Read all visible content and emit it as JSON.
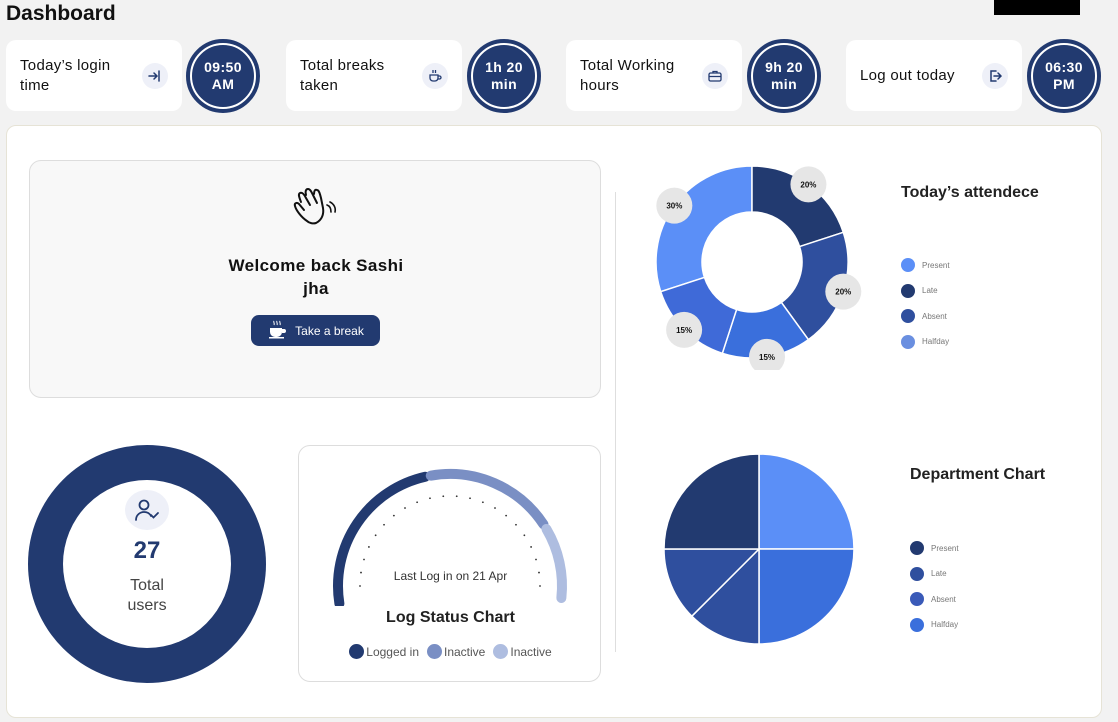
{
  "header": {
    "title": "Dashboard"
  },
  "stats": [
    {
      "label": "Today’s login time",
      "value": "09:50 AM",
      "icon": "login-arrow-icon"
    },
    {
      "label": "Total breaks taken",
      "value": "1h 20 min",
      "icon": "break-cup-icon"
    },
    {
      "label": "Total Working hours",
      "value": "9h 20 min",
      "icon": "briefcase-icon"
    },
    {
      "label": "Log out today",
      "value": "06:30 PM",
      "icon": "logout-arrow-icon"
    }
  ],
  "welcome": {
    "message": "Welcome back Sashi jha",
    "break_button": "Take a break",
    "icon": "waving-hand-icon"
  },
  "users": {
    "count": "27",
    "label": "Total users",
    "icon": "user-check-icon"
  },
  "log_status": {
    "title": "Log Status Chart",
    "last_login": "Last Log in on 21 Apr",
    "legend": [
      {
        "label": "Logged in",
        "color": "#223a70"
      },
      {
        "label": "Inactive",
        "color": "#7a8fc4"
      },
      {
        "label": "Inactive",
        "color": "#aebde0"
      }
    ]
  },
  "colors": {
    "primary": "#223a70",
    "accent_blue": "#5b8ff7",
    "mid_blue": "#3a6fdc",
    "royal_blue": "#2f4f9e"
  },
  "chart_data": [
    {
      "type": "donut",
      "title": "Today’s attendece",
      "series_labels": [
        "30%",
        "20%",
        "20%",
        "15%",
        "15%"
      ],
      "values": [
        30,
        20,
        20,
        15,
        15
      ],
      "colors": [
        "#5b8ff7",
        "#223a70",
        "#2f4f9e",
        "#3a6fdc",
        "#3f6ad8"
      ],
      "legend": [
        {
          "label": "Present",
          "color": "#5b8ff7"
        },
        {
          "label": "Late",
          "color": "#223a70"
        },
        {
          "label": "Absent",
          "color": "#2f4f9e"
        },
        {
          "label": "Halfday",
          "color": "#6a8fe0"
        }
      ],
      "legend_position": "right"
    },
    {
      "type": "pie",
      "title": "Department Chart",
      "values": [
        25,
        25,
        12.5,
        12.5,
        25
      ],
      "colors": [
        "#5b8ff7",
        "#3a6fdc",
        "#2f4f9e",
        "#2f4f9e",
        "#223a70"
      ],
      "legend": [
        {
          "label": "Present",
          "color": "#223a70"
        },
        {
          "label": "Late",
          "color": "#2f4f9e"
        },
        {
          "label": "Absent",
          "color": "#3a5ab8"
        },
        {
          "label": "Halfday",
          "color": "#3a6fdc"
        }
      ],
      "legend_position": "right"
    },
    {
      "type": "gauge",
      "title": "Log Status Chart",
      "values": [
        45,
        35,
        20
      ],
      "colors": [
        "#223a70",
        "#7a8fc4",
        "#aebde0"
      ]
    }
  ]
}
